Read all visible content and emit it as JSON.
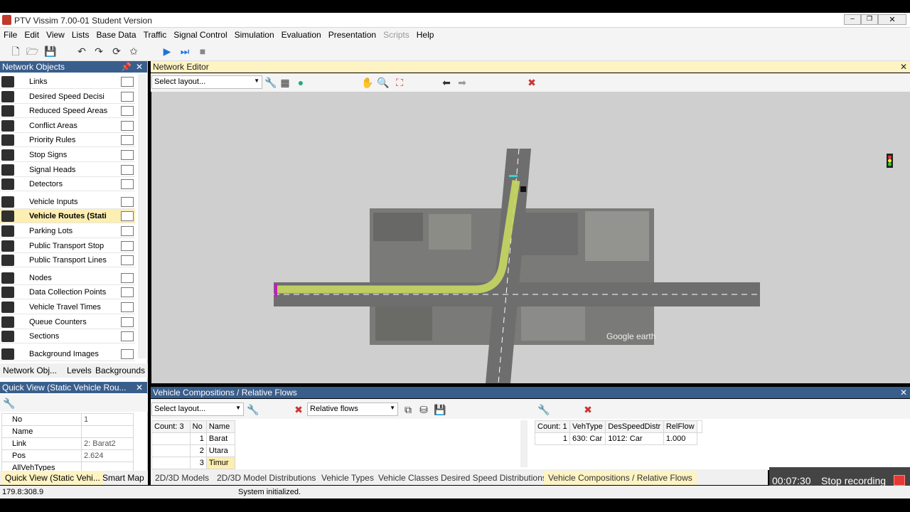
{
  "app": {
    "title": "PTV Vissim 7.00-01 Student Version"
  },
  "menu": [
    "File",
    "Edit",
    "View",
    "Lists",
    "Base Data",
    "Traffic",
    "Signal Control",
    "Simulation",
    "Evaluation",
    "Presentation",
    "Scripts",
    "Help"
  ],
  "network_objects": {
    "title": "Network Objects",
    "items": [
      {
        "label": "Links",
        "icon": "links-icon"
      },
      {
        "label": "Desired Speed Decisi",
        "icon": "speed-50-icon"
      },
      {
        "label": "Reduced Speed Areas",
        "icon": "warning-triangle-icon"
      },
      {
        "label": "Conflict Areas",
        "icon": "conflict-icon"
      },
      {
        "label": "Priority Rules",
        "icon": "yield-icon"
      },
      {
        "label": "Stop Signs",
        "icon": "stop-sign-icon"
      },
      {
        "label": "Signal Heads",
        "icon": "traffic-light-icon"
      },
      {
        "label": "Detectors",
        "icon": "detector-icon"
      },
      {
        "label": "Vehicle Inputs",
        "icon": "vehicle-input-icon"
      },
      {
        "label": "Vehicle Routes (Stati",
        "icon": "route-icon"
      },
      {
        "label": "Parking Lots",
        "icon": "parking-icon"
      },
      {
        "label": "Public Transport Stop",
        "icon": "pt-stop-icon"
      },
      {
        "label": "Public Transport Lines",
        "icon": "pt-line-icon"
      },
      {
        "label": "Nodes",
        "icon": "node-icon"
      },
      {
        "label": "Data Collection Points",
        "icon": "data-point-icon"
      },
      {
        "label": "Vehicle Travel Times",
        "icon": "stopwatch-icon"
      },
      {
        "label": "Queue Counters",
        "icon": "queue-icon"
      },
      {
        "label": "Sections",
        "icon": "section-icon"
      },
      {
        "label": "Background Images",
        "icon": "image-icon"
      }
    ],
    "selected": "Vehicle Routes (Stati",
    "tabs": [
      "Network Obj...",
      "Levels",
      "Backgrounds"
    ]
  },
  "quick_view": {
    "title": "Quick View  (Static Vehicle Rou...",
    "rows": [
      {
        "k": "No",
        "v": "1"
      },
      {
        "k": "Name",
        "v": ""
      },
      {
        "k": "Link",
        "v": "2: Barat2"
      },
      {
        "k": "Pos",
        "v": "2.624"
      },
      {
        "k": "AllVehTypes",
        "v": ""
      }
    ],
    "tabs": [
      "Quick View  (Static Vehi...",
      "Smart Map"
    ]
  },
  "network_editor": {
    "title": "Network Editor",
    "layout_placeholder": "Select layout...",
    "earth_label": "Google earth"
  },
  "compositions": {
    "title": "Vehicle Compositions / Relative Flows",
    "layout_placeholder": "Select layout...",
    "relflows": "Relative flows",
    "left_table": {
      "count": "Count: 3",
      "headers": [
        "No",
        "Name"
      ],
      "rows": [
        [
          "1",
          "Barat"
        ],
        [
          "2",
          "Utara"
        ],
        [
          "3",
          "Timur"
        ]
      ]
    },
    "right_table": {
      "count": "Count: 1",
      "headers": [
        "VehType",
        "DesSpeedDistr",
        "RelFlow"
      ],
      "rows": [
        [
          "1",
          "630: Car",
          "1012: Car",
          "1.000"
        ]
      ]
    }
  },
  "bottom_tabs": [
    "2D/3D Models",
    "2D/3D Model Distributions",
    "Vehicle Types",
    "Vehicle Classes",
    "Desired Speed Distributions",
    "Vehicle Compositions / Relative Flows"
  ],
  "status": {
    "coords": "179.8:308.9",
    "message": "System initialized."
  },
  "recording": {
    "time": "00:07:30",
    "label": "Stop recording"
  },
  "colors": {
    "panel_header": "#3a5e8c",
    "selection": "#fdeeb2",
    "route": "#c8d860",
    "record": "#e53935"
  }
}
